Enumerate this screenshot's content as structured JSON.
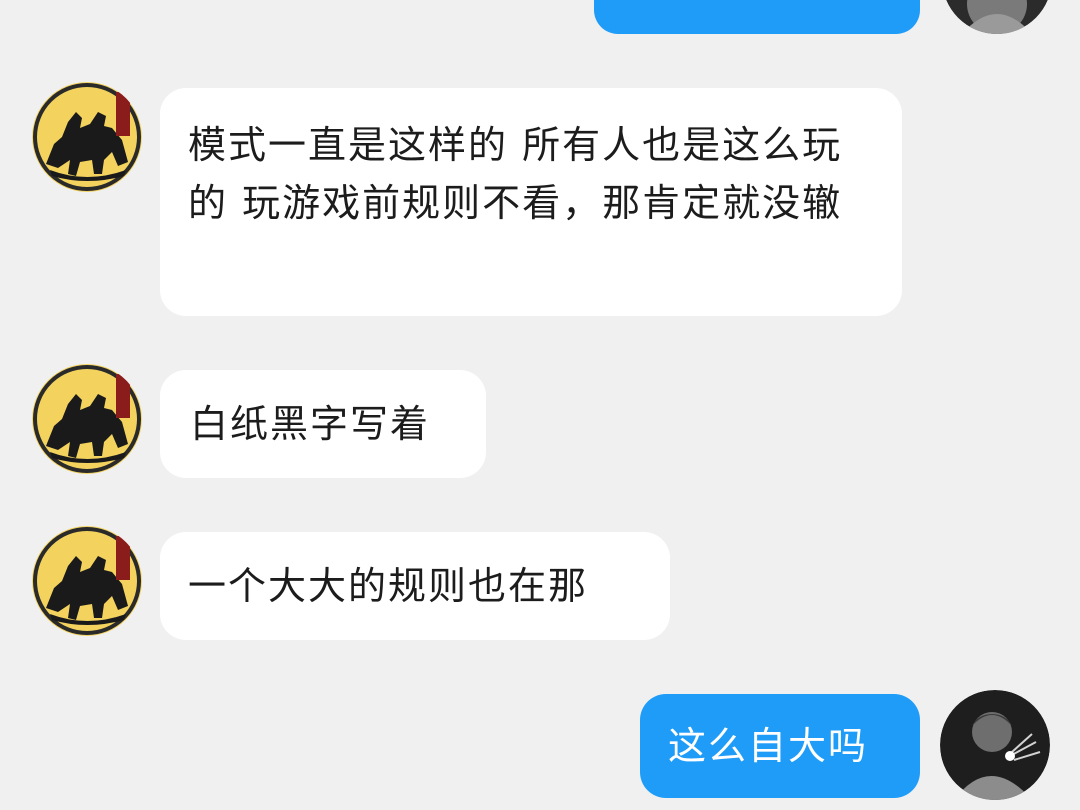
{
  "messages": [
    {
      "side": "out",
      "text": ""
    },
    {
      "side": "in",
      "text": "模式一直是这样的 所有人也是这么玩的 玩游戏前规则不看，那肯定就没辙"
    },
    {
      "side": "in",
      "text": "白纸黑字写着"
    },
    {
      "side": "in",
      "text": "一个大大的规则也在那"
    },
    {
      "side": "out",
      "text": "这么自大吗"
    }
  ],
  "colors": {
    "background": "#f0f0f0",
    "incoming_bubble": "#ffffff",
    "outgoing_bubble": "#1f9cf8",
    "avatar_incoming_bg": "#f3d35e"
  },
  "icons": {
    "incoming_avatar": "horse-riders-avatar-icon",
    "outgoing_avatar": "person-photo-avatar-icon"
  }
}
